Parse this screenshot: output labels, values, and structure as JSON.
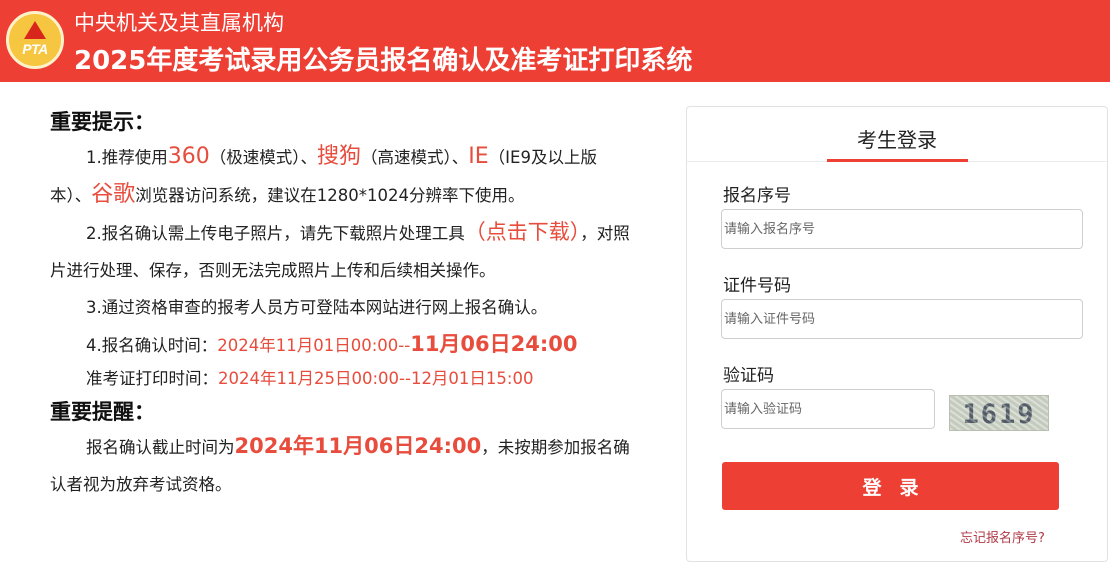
{
  "header": {
    "logo_text": "PTA",
    "org": "中央机关及其直属机构",
    "system_name": "2025年度考试录用公务员报名确认及准考证打印系统"
  },
  "notice": {
    "title": "重要提示：",
    "p1": {
      "a": "1.推荐使用",
      "b1": "360",
      "c": "（极速模式）、",
      "b2": "搜狗",
      "d": "（高速模式）、",
      "b3": "IE",
      "e": "（IE9及以上版本）、",
      "b4": "谷歌",
      "f": "浏览器访问系统，建议在1280*1024分辨率下使用。"
    },
    "p2": {
      "a": "2.报名确认需上传电子照片，请先下载照片处理工具",
      "link": "（点击下载）",
      "b": "，对照片进行处理、保存，否则无法完成照片上传和后续相关操作。"
    },
    "p3": "3.通过资格审查的报考人员方可登陆本网站进行网上报名确认。",
    "p4": {
      "label": "4.报名确认时间：",
      "start": "2024年11月01日00:00--",
      "end": "11月06日24:00"
    },
    "p5": {
      "label": "准考证打印时间：",
      "range": "2024年11月25日00:00--12月01日15:00"
    },
    "reminder_title": "重要提醒：",
    "reminder": {
      "a": "报名确认截止时间为",
      "deadline": "2024年11月06日24:00",
      "b": "，未按期参加报名确认者视为放弃考试资格。"
    }
  },
  "login": {
    "title": "考生登录",
    "reg_label": "报名序号",
    "reg_placeholder": "请输入报名序号",
    "id_label": "证件号码",
    "id_placeholder": "请输入证件号码",
    "captcha_label": "验证码",
    "captcha_placeholder": "请输入验证码",
    "captcha_code": "1619",
    "login_button": "登录",
    "forgot_link": "忘记报名序号?"
  },
  "colors": {
    "brand": "#ee3f35",
    "highlight": "#e74c3c",
    "logo_gold": "#f7c640"
  }
}
